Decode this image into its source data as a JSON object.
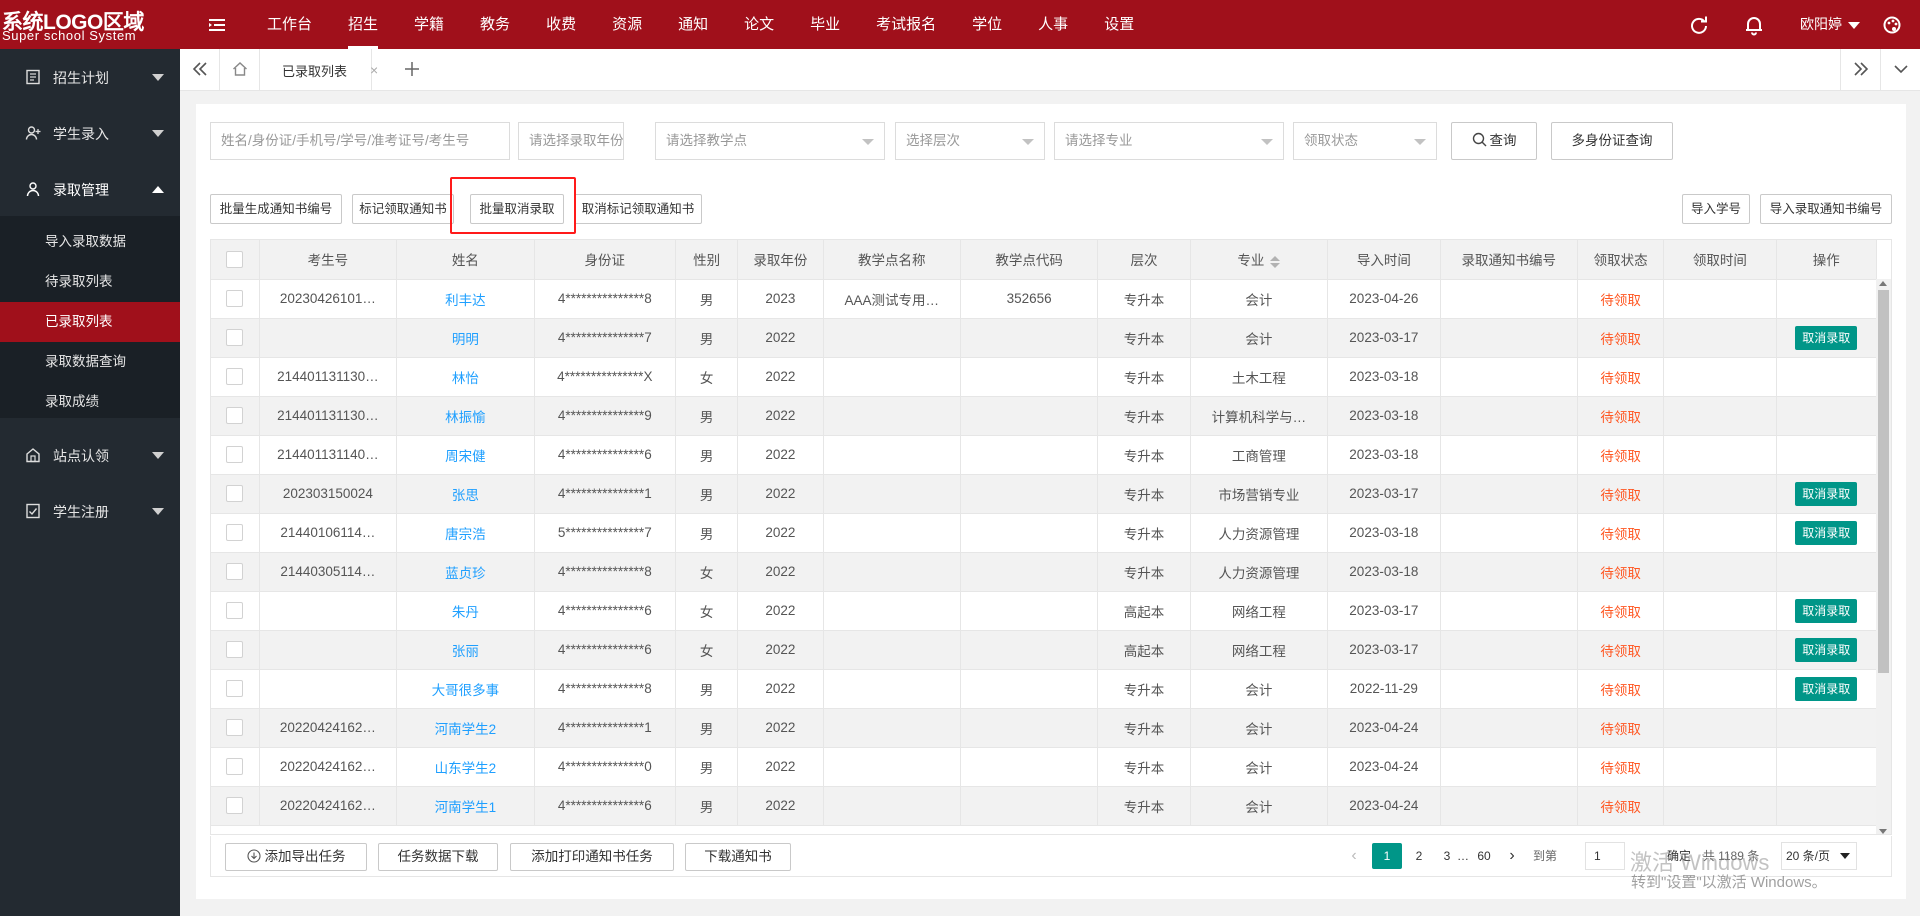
{
  "brand": {
    "title": "系统LOGO区域",
    "subtitle": "Super school System"
  },
  "top_nav": [
    "工作台",
    "招生",
    "学籍",
    "教务",
    "收费",
    "资源",
    "通知",
    "论文",
    "毕业",
    "考试报名",
    "学位",
    "人事",
    "设置"
  ],
  "top_nav_active": "招生",
  "user": {
    "name": "欧阳婷"
  },
  "sidebar": {
    "groups": [
      {
        "label": "招生计划",
        "icon": "plan-icon"
      },
      {
        "label": "学生录入",
        "icon": "user-add-icon"
      },
      {
        "label": "录取管理",
        "icon": "user-icon",
        "open": true
      },
      {
        "label": "站点认领",
        "icon": "site-icon"
      },
      {
        "label": "学生注册",
        "icon": "register-icon"
      }
    ],
    "sub_items": [
      "导入录取数据",
      "待录取列表",
      "已录取列表",
      "录取数据查询",
      "录取成绩"
    ],
    "active_sub": "已录取列表"
  },
  "tabs": {
    "current": "已录取列表",
    "close": "×"
  },
  "filters": {
    "keyword_placeholder": "姓名/身份证/手机号/学号/准考证号/考生号",
    "year_placeholder": "请选择录取年份",
    "site_placeholder": "请选择教学点",
    "level_placeholder": "选择层次",
    "major_placeholder": "请选择专业",
    "status_placeholder": "领取状态",
    "search_label": "查询",
    "multi_id_label": "多身份证查询"
  },
  "actions": {
    "batch_generate": "批量生成通知书编号",
    "mark_received": "标记领取通知书",
    "batch_cancel": "批量取消录取",
    "unmark_received": "取消标记领取通知书",
    "import_student_no": "导入学号",
    "import_notice_no": "导入录取通知书编号"
  },
  "table": {
    "columns": [
      "考生号",
      "姓名",
      "身份证",
      "性别",
      "录取年份",
      "教学点名称",
      "教学点代码",
      "层次",
      "专业",
      "导入时间",
      "录取通知书编号",
      "领取状态",
      "领取时间",
      "操作"
    ],
    "cancel_label": "取消录取",
    "rows": [
      {
        "exam_no": "20230426101…",
        "name": "利丰达",
        "id": "4***************8",
        "gender": "男",
        "year": "2023",
        "site_name": "AAA测试专用…",
        "site_code": "352656",
        "level": "专升本",
        "major": "会计",
        "import_time": "2023-04-26",
        "notice_no": "",
        "status": "待领取",
        "recv_time": "",
        "op": false
      },
      {
        "exam_no": "",
        "name": "明明",
        "id": "4***************7",
        "gender": "男",
        "year": "2022",
        "site_name": "",
        "site_code": "",
        "level": "专升本",
        "major": "会计",
        "import_time": "2023-03-17",
        "notice_no": "",
        "status": "待领取",
        "recv_time": "",
        "op": true
      },
      {
        "exam_no": "214401131130…",
        "name": "林怡",
        "id": "4***************X",
        "gender": "女",
        "year": "2022",
        "site_name": "",
        "site_code": "",
        "level": "专升本",
        "major": "土木工程",
        "import_time": "2023-03-18",
        "notice_no": "",
        "status": "待领取",
        "recv_time": "",
        "op": false
      },
      {
        "exam_no": "214401131130…",
        "name": "林振愉",
        "id": "4***************9",
        "gender": "男",
        "year": "2022",
        "site_name": "",
        "site_code": "",
        "level": "专升本",
        "major": "计算机科学与…",
        "import_time": "2023-03-18",
        "notice_no": "",
        "status": "待领取",
        "recv_time": "",
        "op": false
      },
      {
        "exam_no": "214401131140…",
        "name": "周宋健",
        "id": "4***************6",
        "gender": "男",
        "year": "2022",
        "site_name": "",
        "site_code": "",
        "level": "专升本",
        "major": "工商管理",
        "import_time": "2023-03-18",
        "notice_no": "",
        "status": "待领取",
        "recv_time": "",
        "op": false
      },
      {
        "exam_no": "202303150024",
        "name": "张思",
        "id": "4***************1",
        "gender": "男",
        "year": "2022",
        "site_name": "",
        "site_code": "",
        "level": "专升本",
        "major": "市场营销专业",
        "import_time": "2023-03-17",
        "notice_no": "",
        "status": "待领取",
        "recv_time": "",
        "op": true
      },
      {
        "exam_no": "21440106114…",
        "name": "唐宗浩",
        "id": "5***************7",
        "gender": "男",
        "year": "2022",
        "site_name": "",
        "site_code": "",
        "level": "专升本",
        "major": "人力资源管理",
        "import_time": "2023-03-18",
        "notice_no": "",
        "status": "待领取",
        "recv_time": "",
        "op": true
      },
      {
        "exam_no": "21440305114…",
        "name": "蓝贞珍",
        "id": "4***************8",
        "gender": "女",
        "year": "2022",
        "site_name": "",
        "site_code": "",
        "level": "专升本",
        "major": "人力资源管理",
        "import_time": "2023-03-18",
        "notice_no": "",
        "status": "待领取",
        "recv_time": "",
        "op": false
      },
      {
        "exam_no": "",
        "name": "朱丹",
        "id": "4***************6",
        "gender": "女",
        "year": "2022",
        "site_name": "",
        "site_code": "",
        "level": "高起本",
        "major": "网络工程",
        "import_time": "2023-03-17",
        "notice_no": "",
        "status": "待领取",
        "recv_time": "",
        "op": true
      },
      {
        "exam_no": "",
        "name": "张丽",
        "id": "4***************6",
        "gender": "女",
        "year": "2022",
        "site_name": "",
        "site_code": "",
        "level": "高起本",
        "major": "网络工程",
        "import_time": "2023-03-17",
        "notice_no": "",
        "status": "待领取",
        "recv_time": "",
        "op": true
      },
      {
        "exam_no": "",
        "name": "大哥很多事",
        "id": "4***************8",
        "gender": "男",
        "year": "2022",
        "site_name": "",
        "site_code": "",
        "level": "专升本",
        "major": "会计",
        "import_time": "2022-11-29",
        "notice_no": "",
        "status": "待领取",
        "recv_time": "",
        "op": true
      },
      {
        "exam_no": "20220424162…",
        "name": "河南学生2",
        "id": "4***************1",
        "gender": "男",
        "year": "2022",
        "site_name": "",
        "site_code": "",
        "level": "专升本",
        "major": "会计",
        "import_time": "2023-04-24",
        "notice_no": "",
        "status": "待领取",
        "recv_time": "",
        "op": false
      },
      {
        "exam_no": "20220424162…",
        "name": "山东学生2",
        "id": "4***************0",
        "gender": "男",
        "year": "2022",
        "site_name": "",
        "site_code": "",
        "level": "专升本",
        "major": "会计",
        "import_time": "2023-04-24",
        "notice_no": "",
        "status": "待领取",
        "recv_time": "",
        "op": false
      },
      {
        "exam_no": "20220424162…",
        "name": "河南学生1",
        "id": "4***************6",
        "gender": "男",
        "year": "2022",
        "site_name": "",
        "site_code": "",
        "level": "专升本",
        "major": "会计",
        "import_time": "2023-04-24",
        "notice_no": "",
        "status": "待领取",
        "recv_time": "",
        "op": false
      }
    ]
  },
  "footer": {
    "add_export_task": "添加导出任务",
    "task_data_download": "任务数据下载",
    "add_print_task": "添加打印通知书任务",
    "download_notice": "下载通知书"
  },
  "pagination": {
    "prev": "‹",
    "next": "›",
    "pages": [
      "1",
      "2",
      "3"
    ],
    "ellipsis": "…",
    "last": "60",
    "goto_label": "到第",
    "goto_value": "1",
    "confirm": "确定",
    "total": "共 1189 条",
    "page_size": "20 条/页"
  },
  "watermark": {
    "line1": "激活 Windows",
    "line2": "转到\"设置\"以激活 Windows。"
  },
  "colors": {
    "brand": "#a0101b",
    "sidebar": "#232a31",
    "accent": "#009688",
    "link": "#1e9fff",
    "status": "#ff5722"
  }
}
